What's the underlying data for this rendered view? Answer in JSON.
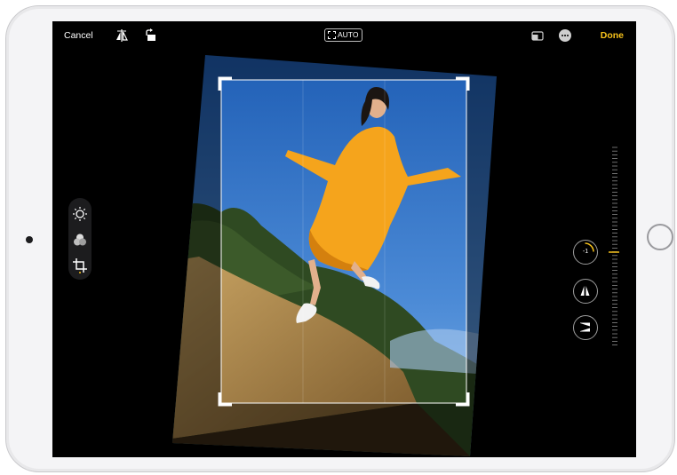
{
  "toolbar": {
    "cancel_label": "Cancel",
    "auto_label": "AUTO",
    "done_label": "Done",
    "accent_color": "#f7c21b"
  },
  "icons": {
    "flip": "flip-icon",
    "rotate": "rotate-icon",
    "aspect": "aspect-ratio-icon",
    "more": "more-icon",
    "adjust": "adjust-icon",
    "filters": "filters-icon",
    "crop": "crop-icon",
    "straighten": "straighten-icon",
    "vertical": "vertical-perspective-icon",
    "horizontal": "horizontal-perspective-icon"
  },
  "adjustment": {
    "straighten_value": "-1"
  }
}
